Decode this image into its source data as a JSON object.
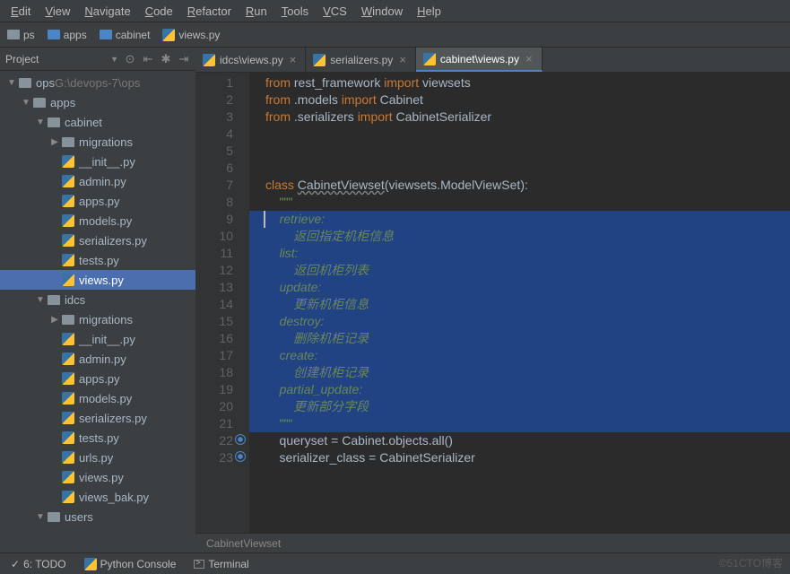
{
  "menu": [
    "Edit",
    "View",
    "Navigate",
    "Code",
    "Refactor",
    "Run",
    "Tools",
    "VCS",
    "Window",
    "Help"
  ],
  "breadcrumbs": [
    {
      "label": "ps",
      "type": "folder"
    },
    {
      "label": "apps",
      "type": "folder-blue"
    },
    {
      "label": "cabinet",
      "type": "folder-blue"
    },
    {
      "label": "views.py",
      "type": "py"
    }
  ],
  "projectTool": {
    "title": "Project"
  },
  "tree": [
    {
      "pad": 0,
      "arrow": "▼",
      "icon": "folder",
      "label": "ops",
      "suffix": " G:\\devops-7\\ops"
    },
    {
      "pad": 16,
      "arrow": "▼",
      "icon": "folder",
      "label": "apps"
    },
    {
      "pad": 32,
      "arrow": "▼",
      "icon": "folder",
      "label": "cabinet"
    },
    {
      "pad": 48,
      "arrow": "▶",
      "icon": "folder",
      "label": "migrations"
    },
    {
      "pad": 48,
      "arrow": "",
      "icon": "py",
      "label": "__init__.py"
    },
    {
      "pad": 48,
      "arrow": "",
      "icon": "py",
      "label": "admin.py"
    },
    {
      "pad": 48,
      "arrow": "",
      "icon": "py",
      "label": "apps.py"
    },
    {
      "pad": 48,
      "arrow": "",
      "icon": "py",
      "label": "models.py"
    },
    {
      "pad": 48,
      "arrow": "",
      "icon": "py",
      "label": "serializers.py"
    },
    {
      "pad": 48,
      "arrow": "",
      "icon": "py",
      "label": "tests.py"
    },
    {
      "pad": 48,
      "arrow": "",
      "icon": "py",
      "label": "views.py",
      "selected": true
    },
    {
      "pad": 32,
      "arrow": "▼",
      "icon": "folder",
      "label": "idcs"
    },
    {
      "pad": 48,
      "arrow": "▶",
      "icon": "folder",
      "label": "migrations"
    },
    {
      "pad": 48,
      "arrow": "",
      "icon": "py",
      "label": "__init__.py"
    },
    {
      "pad": 48,
      "arrow": "",
      "icon": "py",
      "label": "admin.py"
    },
    {
      "pad": 48,
      "arrow": "",
      "icon": "py",
      "label": "apps.py"
    },
    {
      "pad": 48,
      "arrow": "",
      "icon": "py",
      "label": "models.py"
    },
    {
      "pad": 48,
      "arrow": "",
      "icon": "py",
      "label": "serializers.py"
    },
    {
      "pad": 48,
      "arrow": "",
      "icon": "py",
      "label": "tests.py"
    },
    {
      "pad": 48,
      "arrow": "",
      "icon": "py",
      "label": "urls.py"
    },
    {
      "pad": 48,
      "arrow": "",
      "icon": "py",
      "label": "views.py"
    },
    {
      "pad": 48,
      "arrow": "",
      "icon": "py",
      "label": "views_bak.py"
    },
    {
      "pad": 32,
      "arrow": "▼",
      "icon": "folder",
      "label": "users"
    }
  ],
  "tabs": [
    {
      "label": "idcs\\views.py",
      "active": false
    },
    {
      "label": "serializers.py",
      "active": false
    },
    {
      "label": "cabinet\\views.py",
      "active": true
    }
  ],
  "code": [
    {
      "n": 1,
      "html": "<span class='kw'>from</span> rest_framework <span class='kw'>import</span> viewsets"
    },
    {
      "n": 2,
      "html": "<span class='kw'>from</span> .models <span class='kw'>import</span> Cabinet"
    },
    {
      "n": 3,
      "html": "<span class='kw'>from</span> .serializers <span class='kw'>import</span> CabinetSerializer"
    },
    {
      "n": 4,
      "html": ""
    },
    {
      "n": 5,
      "html": ""
    },
    {
      "n": 6,
      "html": ""
    },
    {
      "n": 7,
      "html": "<span class='kw'>class</span> <span class='underline-wavy'>CabinetViewset</span>(viewsets.<span>ModelViewSet</span>):"
    },
    {
      "n": 8,
      "html": "    <span class='docq'>\"\"\"</span>"
    },
    {
      "n": 9,
      "html": "    <span class='str'>retrieve:</span>",
      "sel": true,
      "caret": true
    },
    {
      "n": 10,
      "html": "        <span class='str'>返回指定机柜信息</span>",
      "sel": true
    },
    {
      "n": 11,
      "html": "    <span class='str'>list:</span>",
      "sel": true
    },
    {
      "n": 12,
      "html": "        <span class='str'>返回机柜列表</span>",
      "sel": true
    },
    {
      "n": 13,
      "html": "    <span class='str'>update:</span>",
      "sel": true
    },
    {
      "n": 14,
      "html": "        <span class='str'>更新机柜信息</span>",
      "sel": true
    },
    {
      "n": 15,
      "html": "    <span class='str'>destroy:</span>",
      "sel": true
    },
    {
      "n": 16,
      "html": "        <span class='str'>删除机柜记录</span>",
      "sel": true
    },
    {
      "n": 17,
      "html": "    <span class='str'>create:</span>",
      "sel": true
    },
    {
      "n": 18,
      "html": "        <span class='str'>创建机柜记录</span>",
      "sel": true
    },
    {
      "n": 19,
      "html": "    <span class='str'>partial_update:</span>",
      "sel": true
    },
    {
      "n": 20,
      "html": "        <span class='str'>更新部分字段</span>",
      "sel": true
    },
    {
      "n": 21,
      "html": "    <span class='docq'>\"\"\"</span>",
      "sel": true
    },
    {
      "n": 22,
      "html": "    queryset = Cabinet.objects.all()",
      "gicon": "override"
    },
    {
      "n": 23,
      "html": "    serializer_class = CabinetSerializer",
      "gicon": "override"
    }
  ],
  "crumb": "CabinetViewset",
  "status": [
    {
      "icon": "check",
      "label": "6: TODO"
    },
    {
      "icon": "py",
      "label": "Python Console"
    },
    {
      "icon": "term",
      "label": "Terminal"
    }
  ],
  "watermark": "©51CTO博客"
}
